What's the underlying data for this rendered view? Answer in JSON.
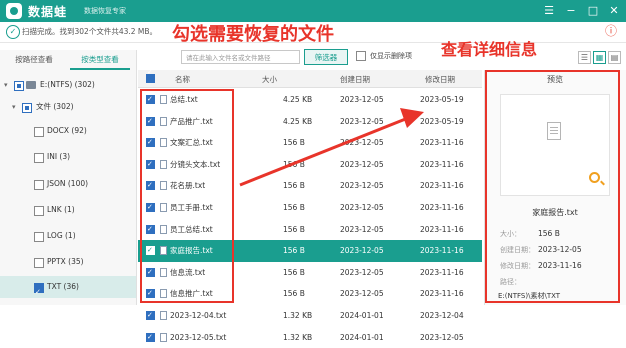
{
  "titlebar": {
    "app_name": "数据蛙",
    "app_subtitle": "数据恢复专家",
    "window_buttons": [
      "☰",
      "−",
      "□",
      "✕"
    ]
  },
  "status": {
    "text": "扫描完成。找到302个文件共43.2 MB。"
  },
  "left": {
    "tabs": [
      "按路径查看",
      "按类型查看"
    ],
    "tree": [
      {
        "label": "E:(NTFS) (302)",
        "state": "partial",
        "level": 0,
        "expanded": true
      },
      {
        "label": "文件 (302)",
        "state": "partial",
        "level": 1,
        "expanded": true
      },
      {
        "label": "DOCX (92)",
        "state": "none",
        "level": 2
      },
      {
        "label": "INI (3)",
        "state": "none",
        "level": 2
      },
      {
        "label": "JSON (100)",
        "state": "none",
        "level": 2
      },
      {
        "label": "LNK (1)",
        "state": "none",
        "level": 2
      },
      {
        "label": "LOG (1)",
        "state": "none",
        "level": 2
      },
      {
        "label": "PPTX (35)",
        "state": "none",
        "level": 2
      },
      {
        "label": "TXT (36)",
        "state": "checked",
        "level": 2,
        "selected": true
      }
    ]
  },
  "toolbar": {
    "search_placeholder": "请在此输入文件名或文件路径",
    "filter_label": "筛选器",
    "deleted_only_label": "仅显示删除项"
  },
  "table": {
    "headers": {
      "name": "名称",
      "size": "大小",
      "created": "创建日期",
      "modified": "修改日期"
    },
    "rows": [
      {
        "name": "总结.txt",
        "size": "4.25 KB",
        "created": "2023-12-05",
        "modified": "2023-05-19"
      },
      {
        "name": "产品推广.txt",
        "size": "4.25 KB",
        "created": "2023-12-05",
        "modified": "2023-05-19"
      },
      {
        "name": "文案汇总.txt",
        "size": "156 B",
        "created": "2023-12-05",
        "modified": "2023-11-16"
      },
      {
        "name": "分镜头文本.txt",
        "size": "156 B",
        "created": "2023-12-05",
        "modified": "2023-11-16"
      },
      {
        "name": "花名册.txt",
        "size": "156 B",
        "created": "2023-12-05",
        "modified": "2023-11-16"
      },
      {
        "name": "员工手册.txt",
        "size": "156 B",
        "created": "2023-12-05",
        "modified": "2023-11-16"
      },
      {
        "name": "员工总结.txt",
        "size": "156 B",
        "created": "2023-12-05",
        "modified": "2023-11-16"
      },
      {
        "name": "家庭报告.txt",
        "size": "156 B",
        "created": "2023-12-05",
        "modified": "2023-11-16",
        "selected": true
      },
      {
        "name": "信息流.txt",
        "size": "156 B",
        "created": "2023-12-05",
        "modified": "2023-11-16"
      },
      {
        "name": "信息推广.txt",
        "size": "156 B",
        "created": "2023-12-05",
        "modified": "2023-11-16"
      },
      {
        "name": "2023-12-04.txt",
        "size": "1.32 KB",
        "created": "2024-01-01",
        "modified": "2023-12-04"
      },
      {
        "name": "2023-12-05.txt",
        "size": "1.32 KB",
        "created": "2024-01-01",
        "modified": "2023-12-05"
      }
    ]
  },
  "preview": {
    "title": "预览",
    "file_name": "家庭报告.txt",
    "size_label": "大小：",
    "size": "156 B",
    "created_label": "创建日期：",
    "created": "2023-12-05",
    "modified_label": "修改日期：",
    "modified": "2023-11-16",
    "path_label": "路径：",
    "path": "E:(NTFS)\\素材\\TXT"
  },
  "annotations": {
    "select_files": "勾选需要恢复的文件",
    "view_details": "查看详细信息"
  },
  "colors": {
    "accent": "#1a9e8f",
    "annotation": "#e8342a",
    "checkbox": "#2f6fbf"
  }
}
